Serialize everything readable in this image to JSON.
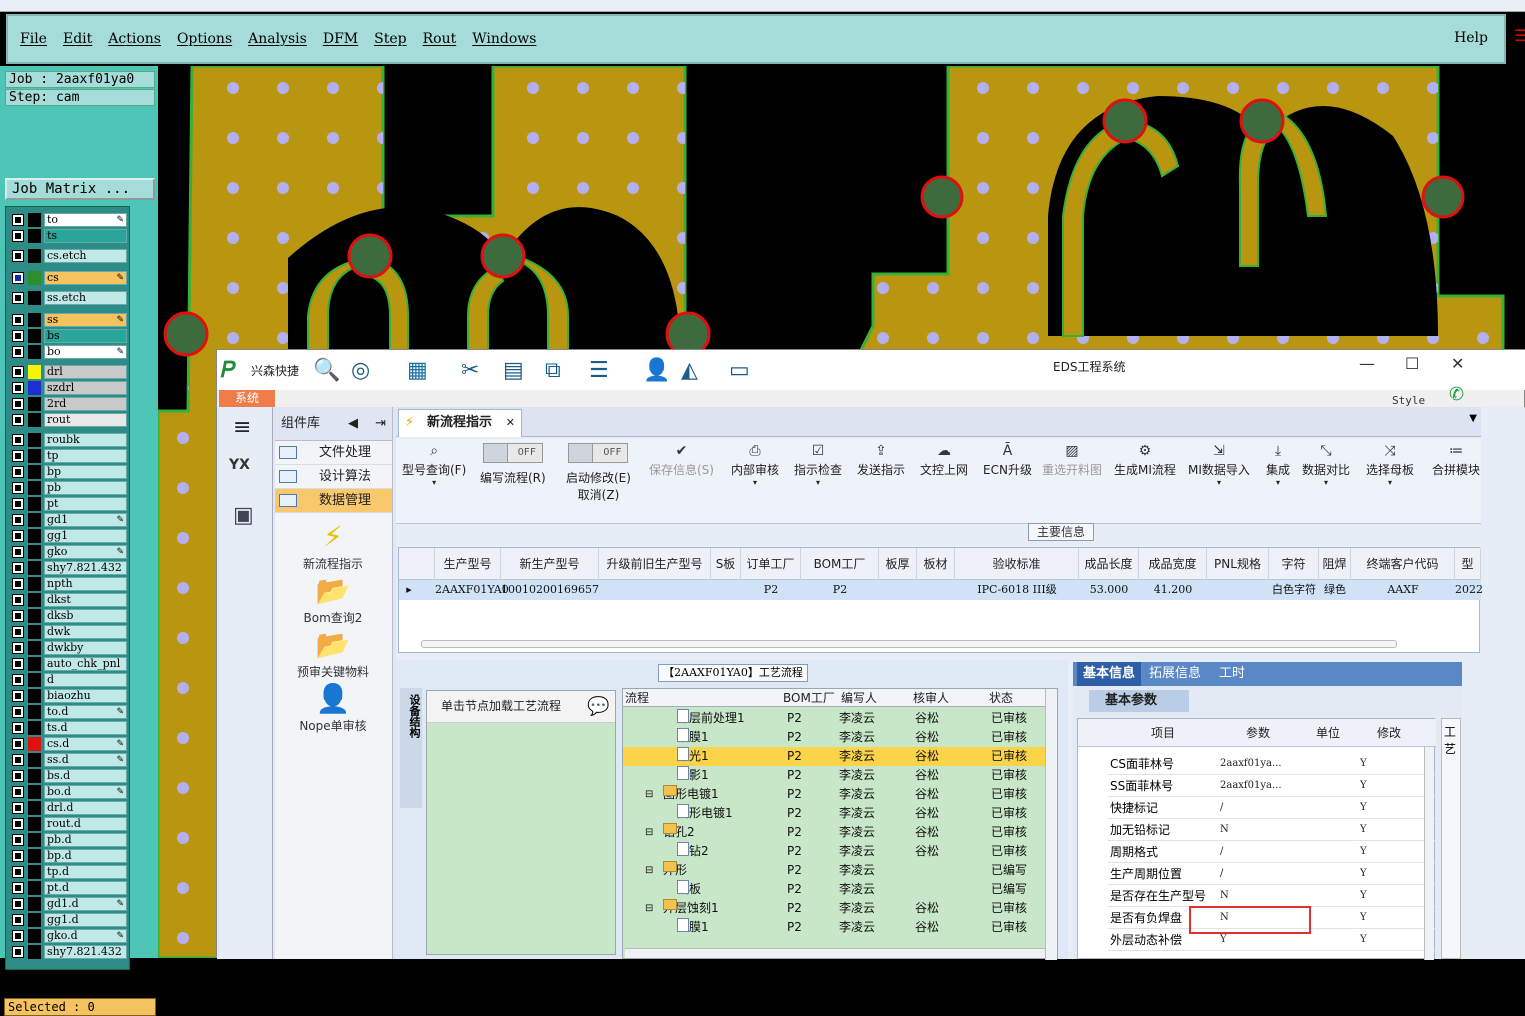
{
  "menu": [
    "File",
    "Edit",
    "Actions",
    "Options",
    "Analysis",
    "DFM",
    "Step",
    "Rout",
    "Windows"
  ],
  "help": "Help",
  "job": {
    "job_label": "Job : 2aaxf01ya0",
    "step_label": "Step: cam",
    "matrix_button": "Job Matrix ..."
  },
  "layers": [
    {
      "name": "to",
      "color": "#ffffff",
      "edit": true
    },
    {
      "name": "ts",
      "color": "#2aa59a",
      "edit": false
    },
    {
      "name": "cs.etch",
      "color": "#bfe8e6",
      "edit": false
    },
    {
      "name": "cs",
      "color": "#f5c260",
      "edit": true,
      "selected": true
    },
    {
      "name": "ss.etch",
      "color": "#bfe8e6",
      "edit": false
    },
    {
      "name": "ss",
      "color": "#f5c260",
      "edit": true
    },
    {
      "name": "bs",
      "color": "#2aa59a",
      "edit": false
    },
    {
      "name": "bo",
      "color": "#ffffff",
      "edit": true
    },
    {
      "name": "drl",
      "color": "#c9c9c9",
      "edit": false
    },
    {
      "name": "szdrl",
      "color": "#c9c9c9",
      "edit": false
    },
    {
      "name": "2rd",
      "color": "#c9c9c9",
      "edit": false
    },
    {
      "name": "rout",
      "color": "#e8e8e8",
      "edit": false
    },
    {
      "name": "roubk",
      "color": "#bfe8e6",
      "edit": false
    },
    {
      "name": "tp",
      "color": "#bfe8e6",
      "edit": false
    },
    {
      "name": "bp",
      "color": "#bfe8e6",
      "edit": false
    },
    {
      "name": "pb",
      "color": "#bfe8e6",
      "edit": false
    },
    {
      "name": "pt",
      "color": "#bfe8e6",
      "edit": false
    },
    {
      "name": "gd1",
      "color": "#bfe8e6",
      "edit": true
    },
    {
      "name": "gg1",
      "color": "#bfe8e6",
      "edit": false
    },
    {
      "name": "gko",
      "color": "#bfe8e6",
      "edit": true
    },
    {
      "name": "shy7.821.432",
      "color": "#bfe8e6",
      "edit": false
    },
    {
      "name": "npth",
      "color": "#bfe8e6",
      "edit": false
    },
    {
      "name": "dkst",
      "color": "#bfe8e6",
      "edit": false
    },
    {
      "name": "dksb",
      "color": "#bfe8e6",
      "edit": false
    },
    {
      "name": "dwk",
      "color": "#bfe8e6",
      "edit": false
    },
    {
      "name": "dwkby",
      "color": "#bfe8e6",
      "edit": false
    },
    {
      "name": "auto_chk_pnl",
      "color": "#bfe8e6",
      "edit": false
    },
    {
      "name": "d",
      "color": "#bfe8e6",
      "edit": false
    },
    {
      "name": "biaozhu",
      "color": "#bfe8e6",
      "edit": false
    },
    {
      "name": "to.d",
      "color": "#bfe8e6",
      "edit": true
    },
    {
      "name": "ts.d",
      "color": "#bfe8e6",
      "edit": false
    },
    {
      "name": "cs.d",
      "color": "#bfe8e6",
      "edit": true
    },
    {
      "name": "ss.d",
      "color": "#bfe8e6",
      "edit": true
    },
    {
      "name": "bs.d",
      "color": "#bfe8e6",
      "edit": false
    },
    {
      "name": "bo.d",
      "color": "#bfe8e6",
      "edit": true
    },
    {
      "name": "drl.d",
      "color": "#bfe8e6",
      "edit": false
    },
    {
      "name": "rout.d",
      "color": "#bfe8e6",
      "edit": false
    },
    {
      "name": "pb.d",
      "color": "#bfe8e6",
      "edit": false
    },
    {
      "name": "bp.d",
      "color": "#bfe8e6",
      "edit": false
    },
    {
      "name": "tp.d",
      "color": "#bfe8e6",
      "edit": false
    },
    {
      "name": "pt.d",
      "color": "#bfe8e6",
      "edit": false
    },
    {
      "name": "gd1.d",
      "color": "#bfe8e6",
      "edit": true
    },
    {
      "name": "gg1.d",
      "color": "#bfe8e6",
      "edit": false
    },
    {
      "name": "gko.d",
      "color": "#bfe8e6",
      "edit": true
    },
    {
      "name": "shy7.821.432",
      "color": "#bfe8e6",
      "edit": false
    }
  ],
  "selected_label": "Selected : 0",
  "eds": {
    "brand": "兴森快捷",
    "window_title": "EDS工程系统",
    "system_tab": "系统",
    "style_label": "Style",
    "component_lib": "组件库",
    "lib_items": [
      "文件处理",
      "设计算法",
      "数据管理"
    ],
    "lib_tools": [
      "新流程指示",
      "Bom查询2",
      "预审关键物料",
      "Nope单审核"
    ],
    "doc_tab": "新流程指示",
    "buttons": {
      "query": "型号查询(F)",
      "edit_flow": "编写流程(R)",
      "start_modify": "启动修改(E)",
      "cancel": "取消(Z)",
      "save_info": "保存信息(S)",
      "internal_review": "内部审核",
      "instruction_check": "指示检查",
      "send_instruction": "发送指示",
      "doc_online": "文控上网",
      "ecn": "ECN升级",
      "reselect": "重选开料图",
      "gen_mi": "生成MI流程",
      "mi_import": "MI数据导入",
      "integrate": "集成",
      "compare": "数据对比",
      "select_mother": "选择母板",
      "merge": "合拼模块",
      "off": "OFF"
    },
    "main_info": "主要信息",
    "grid_headers": [
      "生产型号",
      "新生产型号",
      "升级前旧生产型号",
      "S板",
      "订单工厂",
      "BOM工厂",
      "板厚",
      "板材",
      "验收标准",
      "成品长度",
      "成品宽度",
      "PNL规格",
      "字符",
      "阻焊",
      "终端客户代码",
      "型"
    ],
    "grid_row": [
      "2AAXF01YA0",
      "10010200169657",
      "",
      "",
      "P2",
      "P2",
      "",
      "",
      "IPC-6018 III级",
      "53.000",
      "41.200",
      "",
      "白色字符",
      "绿色",
      "AAXF",
      "2022"
    ],
    "process_title": "【2AAXF01YA0】工艺流程",
    "side_label": "设备结构",
    "hint_text": "单击节点加载工艺流程",
    "tree_headers": [
      "流程",
      "BOM工厂",
      "编写人",
      "核审人",
      "状态"
    ],
    "tree_rows": [
      {
        "name": "外层前处理1",
        "f": "P2",
        "w": "李凌云",
        "r": "谷松",
        "s": "已审核",
        "lvl": 2
      },
      {
        "name": "贴膜1",
        "f": "P2",
        "w": "李凌云",
        "r": "谷松",
        "s": "已审核",
        "lvl": 2
      },
      {
        "name": "曝光1",
        "f": "P2",
        "w": "李凌云",
        "r": "谷松",
        "s": "已审核",
        "lvl": 2,
        "hl": true
      },
      {
        "name": "显影1",
        "f": "P2",
        "w": "李凌云",
        "r": "谷松",
        "s": "已审核",
        "lvl": 2
      },
      {
        "name": "图形电镀1",
        "f": "P2",
        "w": "李凌云",
        "r": "谷松",
        "s": "已审核",
        "lvl": 1
      },
      {
        "name": "图形电镀1",
        "f": "P2",
        "w": "李凌云",
        "r": "谷松",
        "s": "已审核",
        "lvl": 2
      },
      {
        "name": "钻孔2",
        "f": "P2",
        "w": "李凌云",
        "r": "谷松",
        "s": "已审核",
        "lvl": 1
      },
      {
        "name": "二钻2",
        "f": "P2",
        "w": "李凌云",
        "r": "谷松",
        "s": "已审核",
        "lvl": 2
      },
      {
        "name": "外形",
        "f": "P2",
        "w": "李凌云",
        "r": "",
        "s": "已编写",
        "lvl": 1
      },
      {
        "name": "铣板",
        "f": "P2",
        "w": "李凌云",
        "r": "",
        "s": "已编写",
        "lvl": 2
      },
      {
        "name": "外层蚀刻1",
        "f": "P2",
        "w": "李凌云",
        "r": "谷松",
        "s": "已审核",
        "lvl": 1
      },
      {
        "name": "退膜1",
        "f": "P2",
        "w": "李凌云",
        "r": "谷松",
        "s": "已审核",
        "lvl": 2
      }
    ],
    "info_tabs": [
      "基本信息",
      "拓展信息",
      "工时"
    ],
    "basic_params": "基本参数",
    "param_headers": [
      "项目",
      "参数",
      "单位",
      "修改"
    ],
    "params": [
      {
        "k": "CS面菲林号",
        "v": "2aaxf01ya...",
        "m": "Y"
      },
      {
        "k": "SS面菲林号",
        "v": "2aaxf01ya...",
        "m": "Y"
      },
      {
        "k": "快捷标记",
        "v": "/",
        "m": "Y"
      },
      {
        "k": "加无铅标记",
        "v": "N",
        "m": "Y"
      },
      {
        "k": "周期格式",
        "v": "/",
        "m": "Y"
      },
      {
        "k": "生产周期位置",
        "v": "/",
        "m": "Y"
      },
      {
        "k": "是否存在生产型号",
        "v": "N",
        "m": "Y"
      },
      {
        "k": "是否有负焊盘",
        "v": "N",
        "m": "Y"
      },
      {
        "k": "外层动态补偿",
        "v": "Y",
        "m": "Y"
      }
    ],
    "right_edge_label": "工艺"
  },
  "colors": {
    "board": "#b8960f",
    "copper_pad": "#3e6b3e",
    "pad_ring": "#e01010",
    "dot": "#b4b0f0",
    "menubar": "#a5dcd9",
    "panel": "#4ec6b7"
  }
}
